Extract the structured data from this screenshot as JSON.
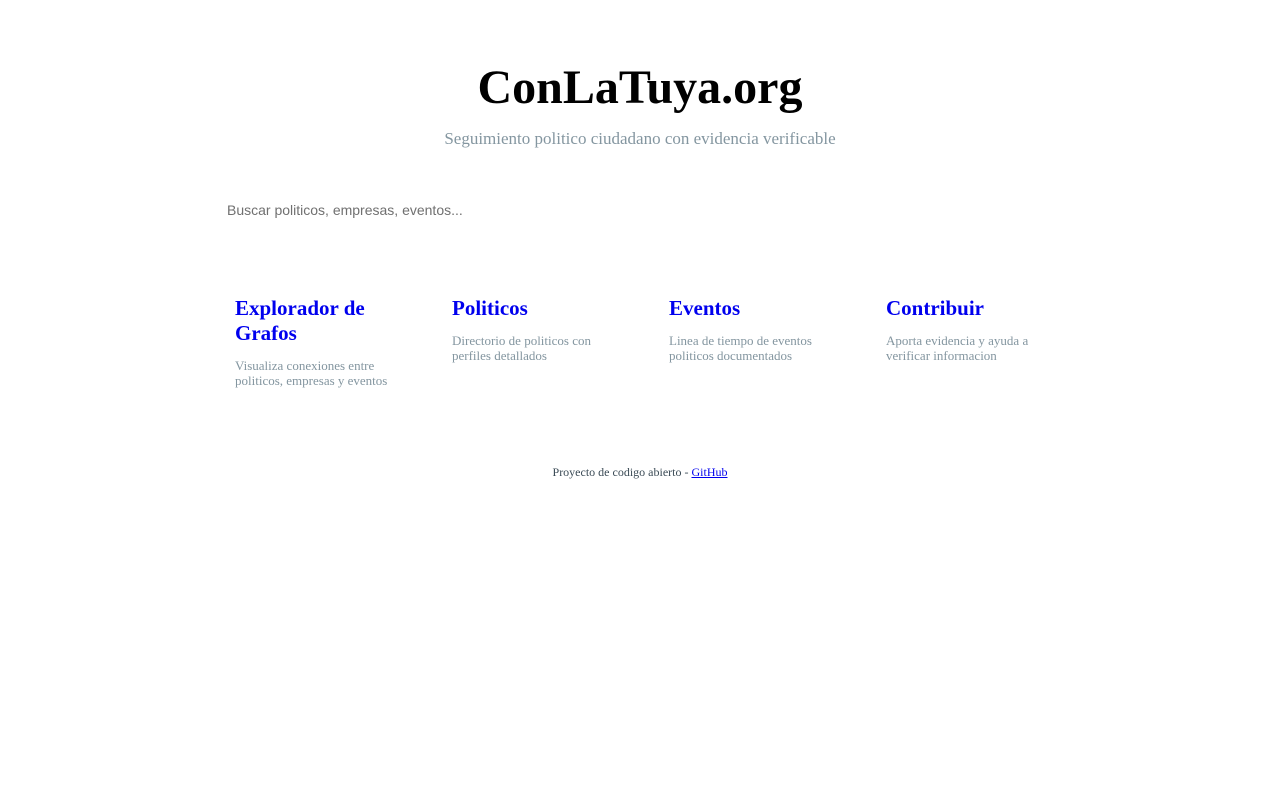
{
  "header": {
    "title": "ConLaTuya.org",
    "subtitle": "Seguimiento politico ciudadano con evidencia verificable"
  },
  "search": {
    "placeholder": "Buscar politicos, empresas, eventos...",
    "value": ""
  },
  "cards": [
    {
      "title": "Explorador de Grafos",
      "description": "Visualiza conexiones entre politicos, empresas y eventos"
    },
    {
      "title": "Politicos",
      "description": "Directorio de politicos con perfiles detallados"
    },
    {
      "title": "Eventos",
      "description": "Linea de tiempo de eventos politicos documentados"
    },
    {
      "title": "Contribuir",
      "description": "Aporta evidencia y ayuda a verificar informacion"
    }
  ],
  "footer": {
    "text": "Proyecto de codigo abierto - ",
    "link_label": "GitHub"
  },
  "colors": {
    "link": "#0000ee",
    "muted": "#8496a0",
    "title": "#000000"
  }
}
